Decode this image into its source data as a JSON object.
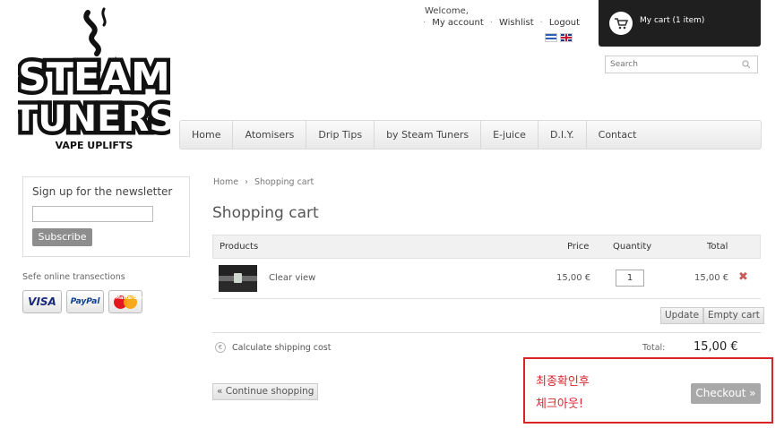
{
  "header": {
    "logo_alt": "Steam Tuners logo",
    "logo_line1": "STEAM",
    "logo_line2": "TUNERS",
    "logo_tagline": "VAPE UPLIFTS",
    "welcome": "Welcome,",
    "links": [
      "My account",
      "Wishlist",
      "Logout"
    ],
    "languages": [
      "greek-flag-icon",
      "english-flag-icon"
    ],
    "cart_label": "My cart (1 item)",
    "search_placeholder": "Search"
  },
  "nav": [
    "Home",
    "Atomisers",
    "Drip Tips",
    "by Steam Tuners",
    "E-juice",
    "D.I.Y.",
    "Contact"
  ],
  "sidebar": {
    "newsletter_title": "Sign up for the newsletter",
    "subscribe_label": "Subscribe",
    "safe_text": "Sefe online transections",
    "payments": [
      "VISA",
      "PayPal",
      "MasterCard"
    ]
  },
  "main": {
    "breadcrumb_home": "Home",
    "breadcrumb_sep": "›",
    "breadcrumb_current": "Shopping cart",
    "title": "Shopping cart",
    "columns": {
      "products": "Products",
      "price": "Price",
      "quantity": "Quantity",
      "total": "Total"
    },
    "items": [
      {
        "name": "Clear view",
        "price": "15,00 €",
        "quantity": "1",
        "total": "15,00 €"
      }
    ],
    "update_label": "Update",
    "empty_label": "Empty cart",
    "shipping_label": "Calculate shipping cost",
    "total_label": "Total:",
    "total_value": "15,00 €",
    "continue_label": "« Continue shopping",
    "checkout_label": "Checkout »"
  },
  "annotation": {
    "line1": "최종확인후",
    "line2": "체크아웃!",
    "color": "#d9232a"
  }
}
